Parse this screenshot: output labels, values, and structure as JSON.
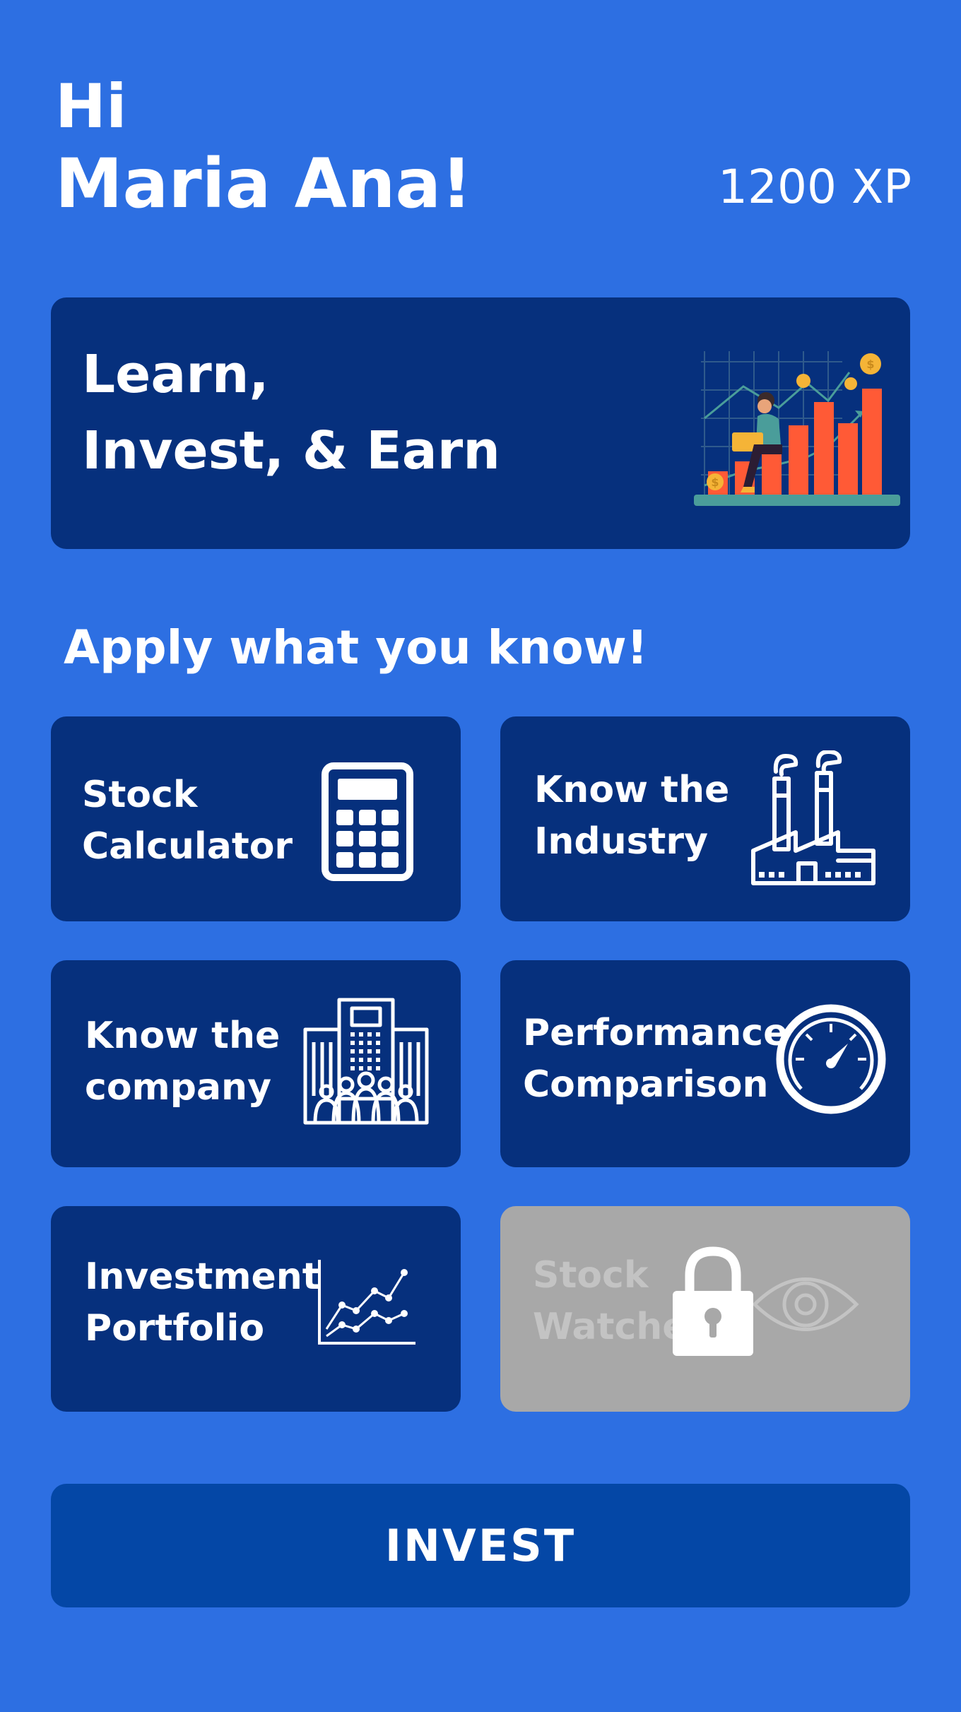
{
  "header": {
    "greeting": "Hi",
    "name": "Maria Ana!",
    "xp": "1200 XP"
  },
  "banner": {
    "line1": "Learn,",
    "line2": "Invest, & Earn",
    "illustration": "investor-growth-chart-illustration"
  },
  "section_title": "Apply what you know!",
  "cards": [
    {
      "line1": "Stock",
      "line2": "Calculator",
      "icon": "calculator-icon",
      "locked": false
    },
    {
      "line1": "Know the",
      "line2": "Industry",
      "icon": "factory-icon",
      "locked": false
    },
    {
      "line1": "Know the",
      "line2": "company",
      "icon": "office-building-icon",
      "locked": false
    },
    {
      "line1": "Performance",
      "line2": "Comparison",
      "icon": "speedometer-icon",
      "locked": false
    },
    {
      "line1": "Investment",
      "line2": "Portfolio",
      "icon": "line-chart-icon",
      "locked": false
    },
    {
      "line1": "Stock",
      "line2": "Watcher",
      "icon": "eye-icon",
      "locked": true,
      "lock_icon": "padlock-icon"
    }
  ],
  "invest_button": "INVEST",
  "colors": {
    "background": "#2d6fe2",
    "card": "#06307d",
    "button": "#0447a6",
    "locked": "#a8a8a8",
    "accent": "#ff5a36"
  }
}
